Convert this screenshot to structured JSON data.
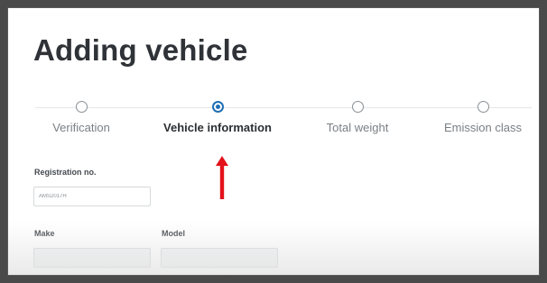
{
  "page": {
    "title": "Adding vehicle"
  },
  "stepper": {
    "steps": [
      {
        "label": "Verification",
        "state": "inactive"
      },
      {
        "label": "Vehicle information",
        "state": "active"
      },
      {
        "label": "Total weight",
        "state": "inactive"
      },
      {
        "label": "Emission class",
        "state": "inactive"
      }
    ]
  },
  "form": {
    "registration": {
      "label": "Registration no.",
      "value": "AMS2017H"
    },
    "make": {
      "label": "Make",
      "value": ""
    },
    "model": {
      "label": "Model",
      "value": ""
    }
  },
  "colors": {
    "accent": "#1f6fb5",
    "annotation_arrow": "#e3121b"
  },
  "annotation": {
    "icon": "red-up-arrow-icon"
  }
}
